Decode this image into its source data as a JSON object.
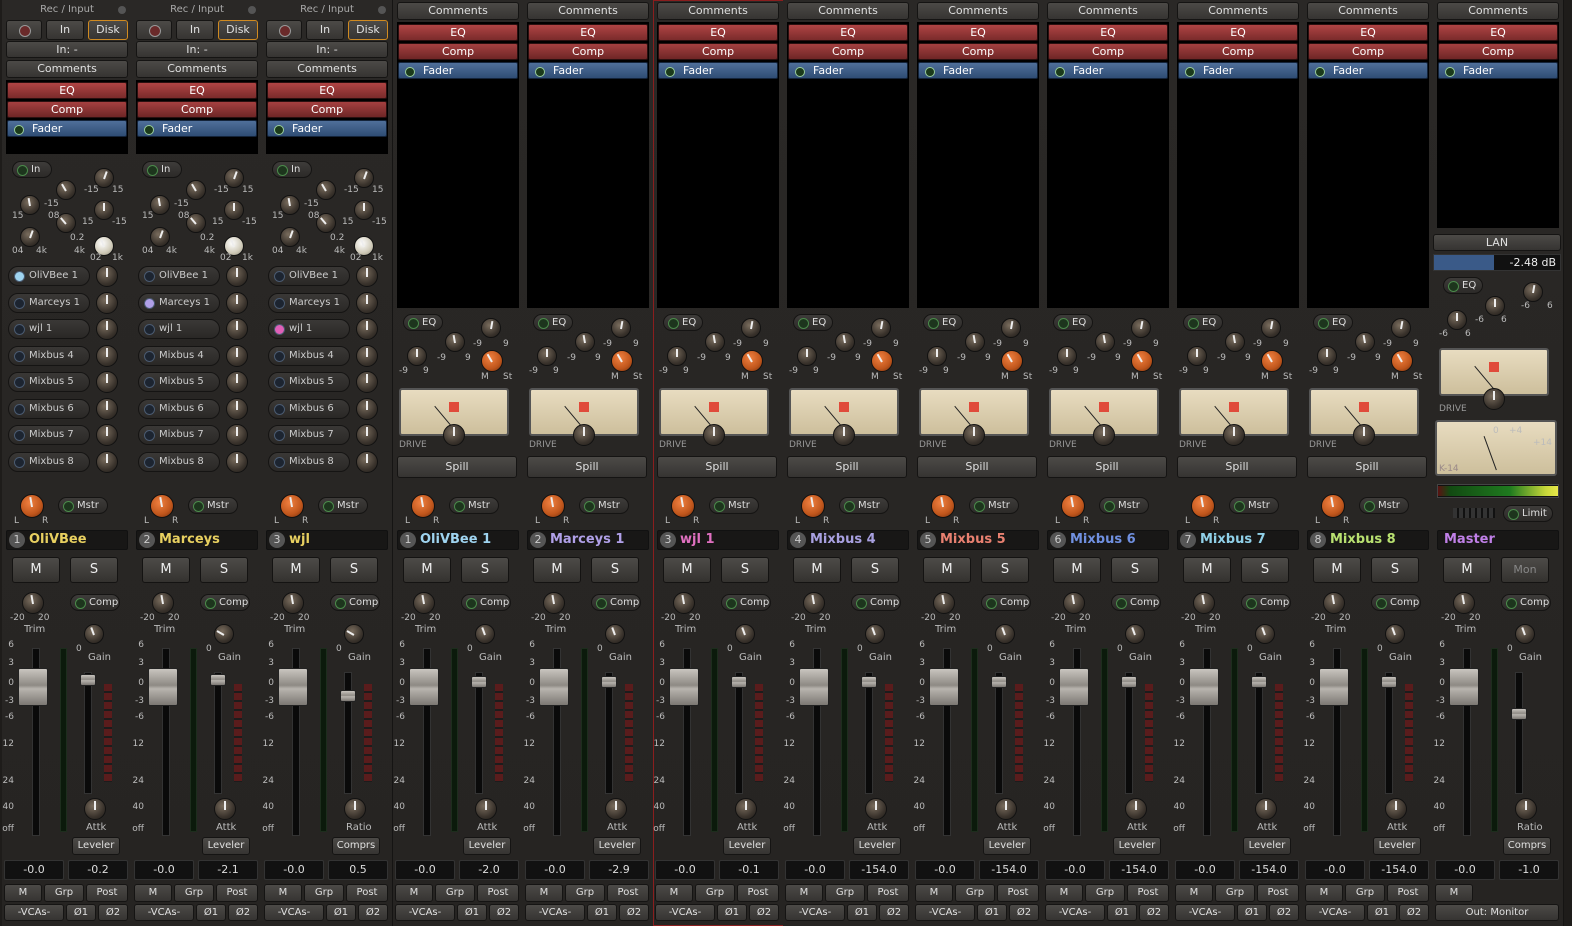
{
  "strips": [
    {
      "type": "audio",
      "num": "1",
      "name": "OliVBee",
      "color": "#e8d060",
      "io": "In: -",
      "plugins": [
        "Comments",
        "EQ",
        "Comp",
        "Fader"
      ],
      "sends": [
        "OliVBee 1",
        "Marceys 1",
        "wjl 1",
        "Mixbus 4",
        "Mixbus 5",
        "Mixbus 6",
        "Mixbus 7",
        "Mixbus 8"
      ],
      "gain_label": "Gain",
      "attk_label": "Attk",
      "comp_mode": "Leveler",
      "fader": "-0.0",
      "comp_val": "-0.2",
      "selected": false
    },
    {
      "type": "audio",
      "num": "2",
      "name": "Marceys",
      "color": "#e8d060",
      "io": "In: -",
      "plugins": [
        "Comments",
        "EQ",
        "Comp",
        "Fader"
      ],
      "sends": [
        "OliVBee 1",
        "Marceys 1",
        "wjl 1",
        "Mixbus 4",
        "Mixbus 5",
        "Mixbus 6",
        "Mixbus 7",
        "Mixbus 8"
      ],
      "gain_label": "Gain",
      "attk_label": "Attk",
      "comp_mode": "Leveler",
      "fader": "-0.0",
      "comp_val": "-2.1",
      "selected": false
    },
    {
      "type": "audio",
      "num": "3",
      "name": "wjl",
      "color": "#e8d060",
      "io": "In: -",
      "plugins": [
        "Comments",
        "EQ",
        "Comp",
        "Fader"
      ],
      "sends": [
        "OliVBee 1",
        "Marceys 1",
        "wjl 1",
        "Mixbus 4",
        "Mixbus 5",
        "Mixbus 6",
        "Mixbus 7",
        "Mixbus 8"
      ],
      "gain_label": "Gain",
      "attk_label": "Ratio",
      "comp_mode": "Comprs",
      "fader": "-0.0",
      "comp_val": "0.5",
      "selected": false
    },
    {
      "type": "bus",
      "num": "1",
      "name": "OliVBee 1",
      "color": "#9fd4f0",
      "plugins": [
        "Comments",
        "EQ",
        "Comp",
        "Fader"
      ],
      "gain_label": "Gain",
      "attk_label": "Attk",
      "comp_mode": "Leveler",
      "fader": "-0.0",
      "comp_val": "-2.0",
      "selected": false
    },
    {
      "type": "bus",
      "num": "2",
      "name": "Marceys 1",
      "color": "#b0a0e8",
      "plugins": [
        "Comments",
        "EQ",
        "Comp",
        "Fader"
      ],
      "gain_label": "Gain",
      "attk_label": "Attk",
      "comp_mode": "Leveler",
      "fader": "-0.0",
      "comp_val": "-2.9",
      "selected": false
    },
    {
      "type": "bus",
      "num": "3",
      "name": "wjl 1",
      "color": "#e070c0",
      "plugins": [
        "Comments",
        "EQ",
        "Comp",
        "Fader"
      ],
      "gain_label": "Gain",
      "attk_label": "Attk",
      "comp_mode": "Leveler",
      "fader": "-0.0",
      "comp_val": "-0.1",
      "selected": true
    },
    {
      "type": "bus",
      "num": "4",
      "name": "Mixbus 4",
      "color": "#a8a0e0",
      "plugins": [
        "Comments",
        "EQ",
        "Comp",
        "Fader"
      ],
      "gain_label": "Gain",
      "attk_label": "Attk",
      "comp_mode": "Leveler",
      "fader": "-0.0",
      "comp_val": "-154.0",
      "selected": false
    },
    {
      "type": "bus",
      "num": "5",
      "name": "Mixbus 5",
      "color": "#e88070",
      "plugins": [
        "Comments",
        "EQ",
        "Comp",
        "Fader"
      ],
      "gain_label": "Gain",
      "attk_label": "Attk",
      "comp_mode": "Leveler",
      "fader": "-0.0",
      "comp_val": "-154.0",
      "selected": false
    },
    {
      "type": "bus",
      "num": "6",
      "name": "Mixbus 6",
      "color": "#7090e0",
      "plugins": [
        "Comments",
        "EQ",
        "Comp",
        "Fader"
      ],
      "gain_label": "Gain",
      "attk_label": "Attk",
      "comp_mode": "Leveler",
      "fader": "-0.0",
      "comp_val": "-154.0",
      "selected": false
    },
    {
      "type": "bus",
      "num": "7",
      "name": "Mixbus 7",
      "color": "#90d0e8",
      "plugins": [
        "Comments",
        "EQ",
        "Comp",
        "Fader"
      ],
      "gain_label": "Gain",
      "attk_label": "Attk",
      "comp_mode": "Leveler",
      "fader": "-0.0",
      "comp_val": "-154.0",
      "selected": false
    },
    {
      "type": "bus",
      "num": "8",
      "name": "Mixbus 8",
      "color": "#b8e070",
      "plugins": [
        "Comments",
        "EQ",
        "Comp",
        "Fader"
      ],
      "gain_label": "Gain",
      "attk_label": "Attk",
      "comp_mode": "Leveler",
      "fader": "-0.0",
      "comp_val": "-154.0",
      "selected": false
    },
    {
      "type": "master",
      "num": "",
      "name": "Master",
      "color": "#c080e8",
      "plugins": [
        "Comments",
        "EQ",
        "Comp",
        "Fader"
      ],
      "gain_label": "Gain",
      "attk_label": "Ratio",
      "comp_mode": "Comprs",
      "fader": "-0.0",
      "comp_val": "-1.0",
      "selected": false
    }
  ],
  "labels": {
    "rec_input": "Rec / Input",
    "in": "In",
    "disk": "Disk",
    "eq_in": "In",
    "eq_btn": "EQ",
    "drive": "DRIVE",
    "spill": "Spill",
    "mstr": "Mstr",
    "m": "M",
    "s": "S",
    "mon": "Mon",
    "comp": "Comp",
    "trim": "Trim",
    "grp": "Grp",
    "post": "Post",
    "vcas": "-VCAs-",
    "phase1": "Ø1",
    "phase2": "Ø2",
    "lan": "LAN",
    "lan_value": "-2.48 dB",
    "k14": "K-14",
    "limit": "Limit",
    "out": "Out: Monitor",
    "pan_l": "L",
    "pan_r": "R"
  },
  "scale": [
    "6",
    "3",
    "0",
    "-3",
    "-6",
    "12",
    "24",
    "40",
    "off"
  ],
  "eq_ticks": [
    "-15",
    "15",
    "-15",
    "15",
    "08",
    "15",
    "-15",
    "0.2",
    "4k",
    "04",
    "4k",
    "02",
    "1k"
  ],
  "bus_ticks": [
    "-9",
    "9",
    "-9",
    "9",
    "-9",
    "9",
    "M",
    "St"
  ],
  "trim_ticks": [
    "-20",
    "20"
  ],
  "master_ticks": [
    "-6",
    "6",
    "-6",
    "6"
  ],
  "master_vu": [
    "0",
    "+4",
    "+14"
  ]
}
